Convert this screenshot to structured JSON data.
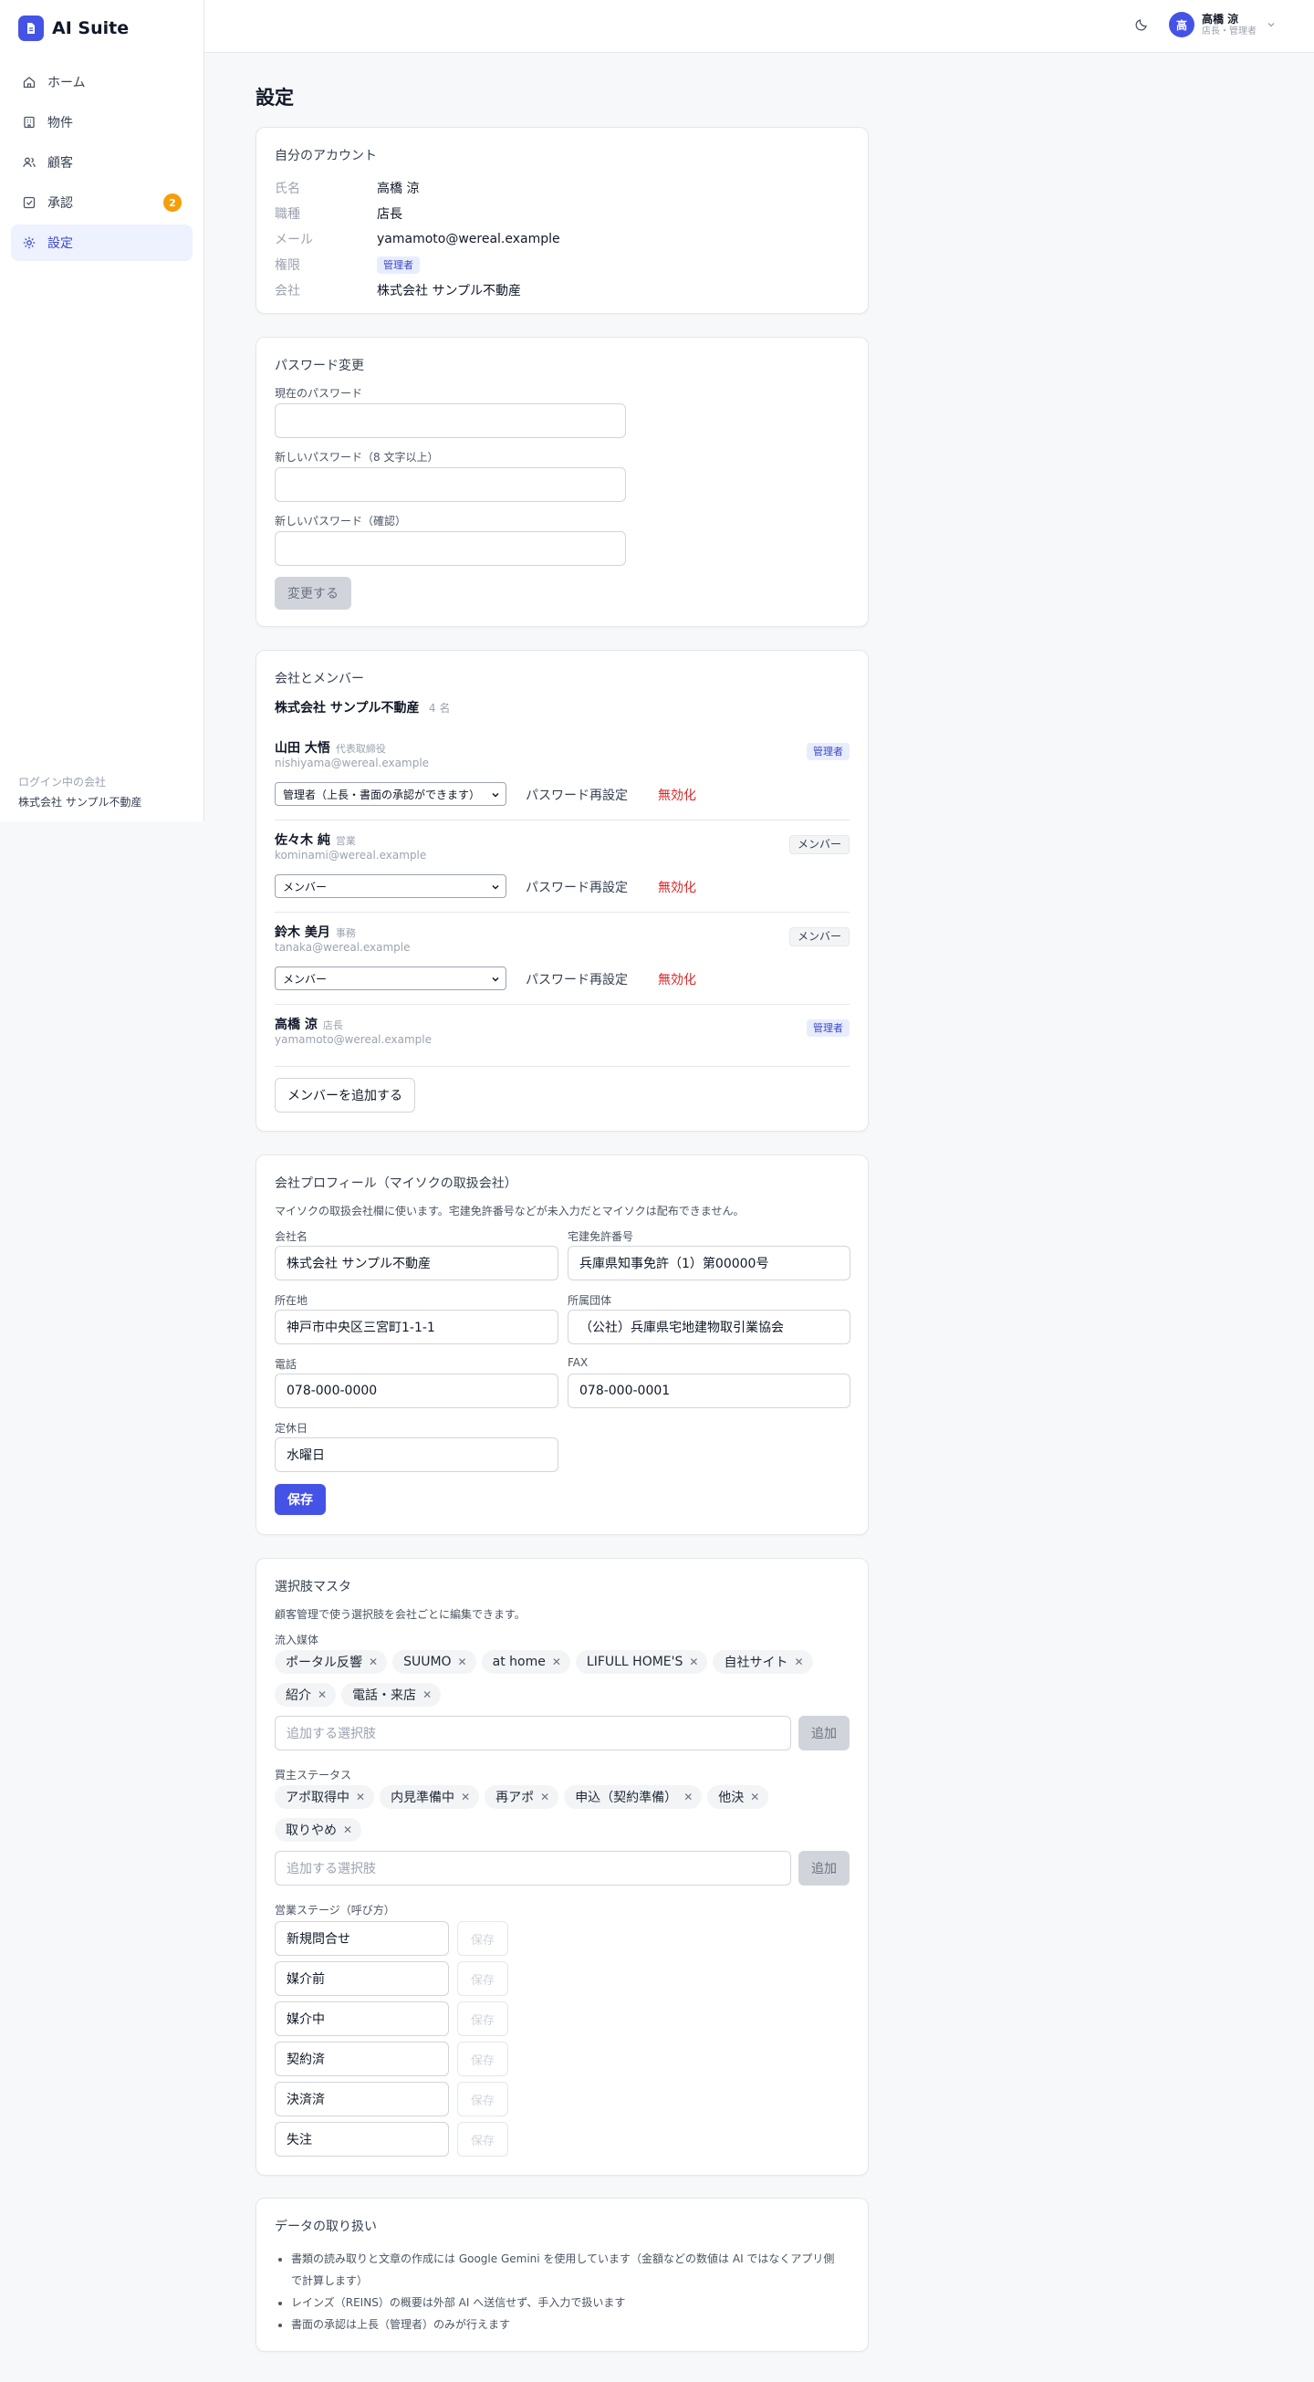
{
  "app": {
    "name": "AI Suite"
  },
  "sidebar": {
    "items": [
      {
        "label": "ホーム",
        "icon": "home-icon"
      },
      {
        "label": "物件",
        "icon": "building-icon"
      },
      {
        "label": "顧客",
        "icon": "users-icon"
      },
      {
        "label": "承認",
        "icon": "check-square-icon",
        "badge": "2"
      },
      {
        "label": "設定",
        "icon": "gear-icon",
        "active": true
      }
    ],
    "footer": {
      "label": "ログイン中の会社",
      "company": "株式会社 サンプル不動産"
    }
  },
  "topbar": {
    "avatar_initial": "高",
    "user_name": "高橋 涼",
    "user_role": "店長・管理者"
  },
  "page": {
    "title": "設定"
  },
  "account": {
    "title": "自分のアカウント",
    "rows": [
      {
        "key": "氏名",
        "value": "高橋 涼"
      },
      {
        "key": "職種",
        "value": "店長"
      },
      {
        "key": "メール",
        "value": "yamamoto@wereal.example"
      },
      {
        "key": "権限",
        "value": "管理者"
      },
      {
        "key": "会社",
        "value": "株式会社 サンプル不動産"
      }
    ]
  },
  "password": {
    "title": "パスワード変更",
    "current_label": "現在のパスワード",
    "new_label": "新しいパスワード（8 文字以上）",
    "confirm_label": "新しいパスワード（確認）",
    "submit_label": "変更する"
  },
  "members": {
    "title": "会社とメンバー",
    "company": "株式会社 サンプル不動産",
    "count": "4 名",
    "reset_label": "パスワード再設定",
    "deactivate_label": "無効化",
    "add_label": "メンバーを追加する",
    "list": [
      {
        "name": "山田 大悟",
        "title": "代表取締役",
        "email": "nishiyama@wereal.example",
        "role_badge": "管理者",
        "role_select": "管理者（上長・書面の承認ができます）"
      },
      {
        "name": "佐々木 純",
        "title": "営業",
        "email": "kominami@wereal.example",
        "role_badge": "メンバー",
        "role_select": "メンバー"
      },
      {
        "name": "鈴木 美月",
        "title": "事務",
        "email": "tanaka@wereal.example",
        "role_badge": "メンバー",
        "role_select": "メンバー"
      },
      {
        "name": "高橋 涼",
        "title": "店長",
        "email": "yamamoto@wereal.example",
        "role_badge": "管理者"
      }
    ]
  },
  "profile": {
    "title": "会社プロフィール（マイソクの取扱会社）",
    "description": "マイソクの取扱会社欄に使います。宅建免許番号などが未入力だとマイソクは配布できません。",
    "fields": {
      "company_name": {
        "label": "会社名",
        "value": "株式会社 サンプル不動産"
      },
      "license": {
        "label": "宅建免許番号",
        "value": "兵庫県知事免許（1）第00000号"
      },
      "address": {
        "label": "所在地",
        "value": "神戸市中央区三宮町1-1-1"
      },
      "association": {
        "label": "所属団体",
        "value": "（公社）兵庫県宅地建物取引業協会"
      },
      "phone": {
        "label": "電話",
        "value": "078-000-0000"
      },
      "fax": {
        "label": "FAX",
        "value": "078-000-0001"
      },
      "holiday": {
        "label": "定休日",
        "value": "水曜日"
      }
    },
    "save_label": "保存"
  },
  "options": {
    "title": "選択肢マスタ",
    "description": "顧客管理で使う選択肢を会社ごとに編集できます。",
    "add_placeholder": "追加する選択肢",
    "add_label": "追加",
    "inflow": {
      "label": "流入媒体",
      "chips": [
        "ポータル反響",
        "SUUMO",
        "at home",
        "LIFULL HOME'S",
        "自社サイト",
        "紹介",
        "電話・来店"
      ]
    },
    "buyer_status": {
      "label": "買主ステータス",
      "chips": [
        "アポ取得中",
        "内見準備中",
        "再アポ",
        "申込（契約準備）",
        "他決",
        "取りやめ"
      ]
    },
    "stages": {
      "label": "営業ステージ（呼び方）",
      "save_label": "保存",
      "items": [
        "新規問合せ",
        "媒介前",
        "媒介中",
        "契約済",
        "決済済",
        "失注"
      ]
    }
  },
  "data_handling": {
    "title": "データの取り扱い",
    "bullets": [
      "書類の読み取りと文章の作成には Google Gemini を使用しています（金額などの数値は AI ではなくアプリ側で計算します）",
      "レインズ（REINS）の概要は外部 AI へ送信せず、手入力で扱います",
      "書面の承認は上長（管理者）のみが行えます"
    ]
  },
  "colors": {
    "accent": "#4453e6",
    "danger": "#dc2626",
    "badge": "#f59e0b"
  }
}
